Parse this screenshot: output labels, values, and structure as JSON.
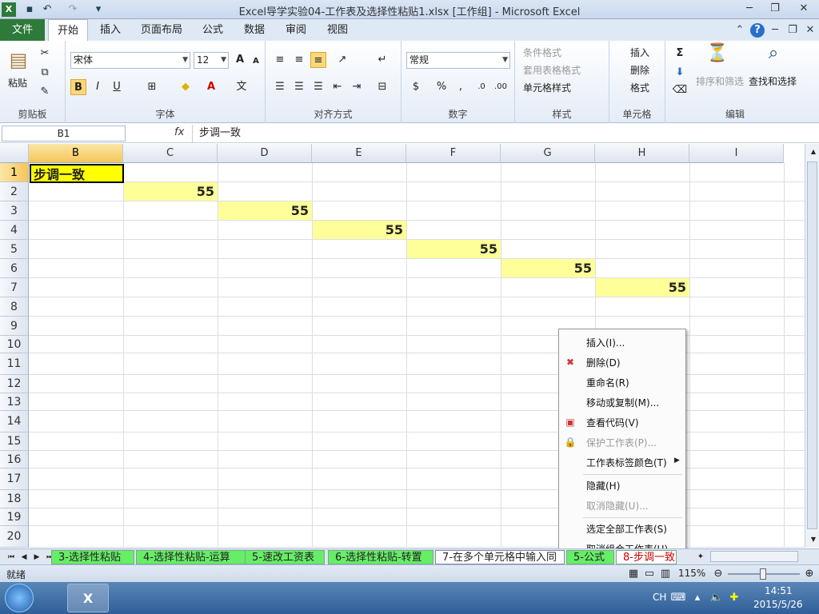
{
  "window": {
    "title": "Excel导学实验04-工作表及选择性粘贴1.xlsx  [工作组]  -  Microsoft Excel"
  },
  "menu": {
    "file": "文件",
    "tabs": [
      "开始",
      "插入",
      "页面布局",
      "公式",
      "数据",
      "审阅",
      "视图"
    ]
  },
  "ribbon": {
    "clipboard": {
      "label": "剪贴板",
      "paste": "粘贴"
    },
    "font": {
      "label": "字体",
      "name": "宋体",
      "size": "12",
      "bold": "B",
      "italic": "I",
      "underline": "U",
      "grow": "A",
      "shrink": "A"
    },
    "align": {
      "label": "对齐方式"
    },
    "number": {
      "label": "数字",
      "format": "常规",
      "percent": "%",
      "comma": ","
    },
    "styles": {
      "label": "样式",
      "cond": "条件格式",
      "table": "套用表格格式",
      "cell": "单元格样式"
    },
    "cells": {
      "label": "单元格",
      "insert": "插入",
      "delete": "删除",
      "format": "格式"
    },
    "edit": {
      "label": "编辑",
      "sort": "排序和筛选",
      "find": "查找和选择"
    }
  },
  "formula": {
    "namebox": "B1",
    "fx": "fx",
    "value": "步调一致"
  },
  "grid": {
    "columns": [
      "B",
      "C",
      "D",
      "E",
      "F",
      "G",
      "H",
      "I"
    ],
    "rows": [
      "1",
      "2",
      "3",
      "4",
      "5",
      "6",
      "7",
      "8",
      "9",
      "10",
      "11",
      "12",
      "13",
      "14",
      "15",
      "16",
      "17",
      "18",
      "19",
      "20"
    ],
    "b1": "步调一致",
    "values": [
      "55",
      "55",
      "55",
      "55",
      "55",
      "55"
    ]
  },
  "context_menu": [
    {
      "label": "插入(I)...",
      "enabled": true,
      "icon": ""
    },
    {
      "label": "删除(D)",
      "enabled": true,
      "icon": "delete-sheet-icon"
    },
    {
      "label": "重命名(R)",
      "enabled": true,
      "icon": ""
    },
    {
      "label": "移动或复制(M)...",
      "enabled": true,
      "icon": ""
    },
    {
      "label": "查看代码(V)",
      "enabled": true,
      "icon": "view-code-icon"
    },
    {
      "label": "保护工作表(P)...",
      "enabled": false,
      "icon": "protect-sheet-icon"
    },
    {
      "label": "工作表标签颜色(T)",
      "enabled": true,
      "icon": ""
    },
    {
      "label": "隐藏(H)",
      "enabled": true,
      "icon": ""
    },
    {
      "label": "取消隐藏(U)...",
      "enabled": false,
      "icon": ""
    },
    {
      "label": "选定全部工作表(S)",
      "enabled": true,
      "icon": ""
    },
    {
      "label": "取消组合工作表(U)",
      "enabled": true,
      "icon": ""
    }
  ],
  "sheets": [
    "3-选择性粘贴",
    "4-选择性粘贴-运算",
    "5-速改工资表",
    "6-选择性粘贴-转置",
    "7-在多个单元格中输入同",
    "5-公式",
    "8-步调一致"
  ],
  "status": {
    "ready": "就绪",
    "zoom": "115%"
  },
  "taskbar": {
    "lang": "CH",
    "time": "14:51",
    "date": "2015/5/26"
  },
  "colors": {
    "highlight": "#ffff99",
    "b1": "#ffff00",
    "sheet_tab": "#66ee66",
    "file_tab": "#2d7a3a"
  }
}
